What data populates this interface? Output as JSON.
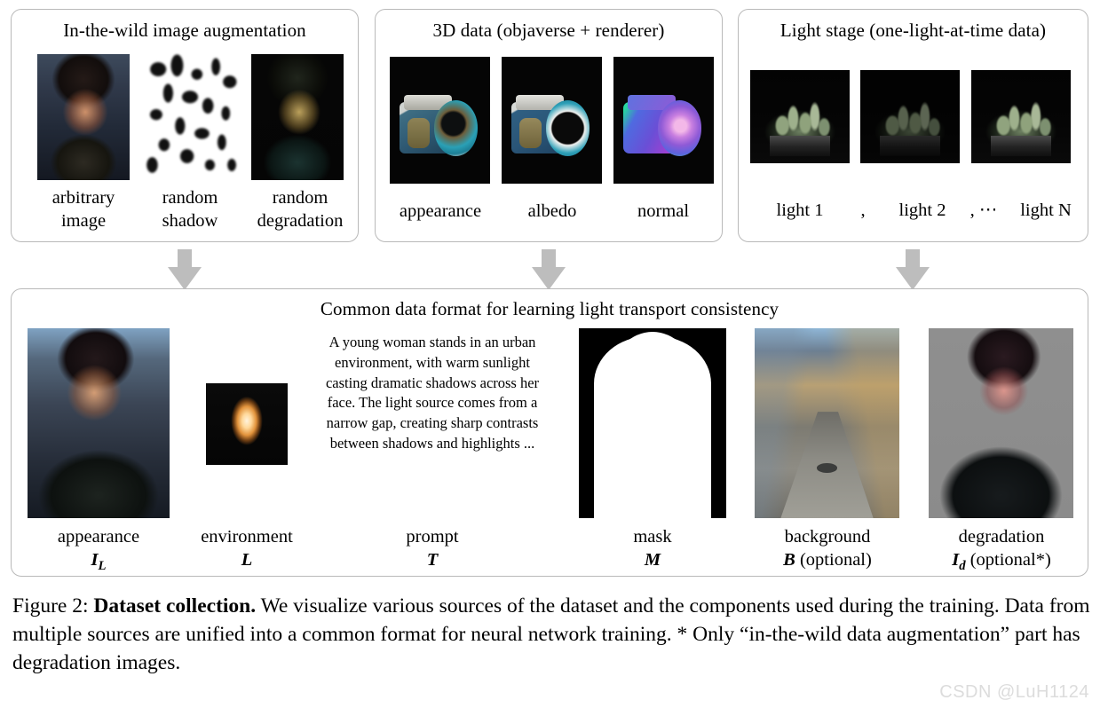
{
  "figure": {
    "caption_prefix": "Figure 2: ",
    "caption_bold": "Dataset collection.",
    "caption_body": " We visualize various sources of the dataset and the components used during the training. Data from multiple sources are unified into a common format for neural network training. * Only “in-the-wild data augmentation” part has degradation images.",
    "watermark": "CSDN @LuH1124"
  },
  "sources": {
    "wild": {
      "title": "In-the-wild image augmentation",
      "items": [
        {
          "label_line1": "arbitrary",
          "label_line2": "image",
          "icon": "portrait-photo"
        },
        {
          "label_line1": "random",
          "label_line2": "shadow",
          "icon": "shadow-mask-photo"
        },
        {
          "label_line1": "random",
          "label_line2": "degradation",
          "icon": "degraded-portrait-photo"
        }
      ]
    },
    "threed": {
      "title": "3D data (objaverse + renderer)",
      "items": [
        {
          "label_line1": "appearance",
          "label_line2": "",
          "icon": "camera-render-appearance"
        },
        {
          "label_line1": "albedo",
          "label_line2": "",
          "icon": "camera-render-albedo"
        },
        {
          "label_line1": "normal",
          "label_line2": "",
          "icon": "camera-render-normal"
        }
      ]
    },
    "lightstage": {
      "title": "Light stage (one-light-at-time data)",
      "items": [
        {
          "label": "light 1",
          "icon": "plant-olat-photo-1"
        },
        {
          "label": "light 2",
          "icon": "plant-olat-photo-2"
        },
        {
          "label": "light N",
          "icon": "plant-olat-photo-n"
        }
      ],
      "separator_1": ",",
      "separator_2": ", ⋯"
    }
  },
  "arrows": {
    "glyph": "down-arrow",
    "color": "#bdbdbd",
    "count": 3
  },
  "common": {
    "title": "Common data format for learning light transport consistency",
    "prompt_text": "A young woman stands in an urban environment, with warm sunlight casting dramatic shadows across her face. The light source comes from a narrow gap, creating sharp contrasts between shadows and highlights ...",
    "items": [
      {
        "name": "appearance",
        "symbol": "I",
        "subscript": "L",
        "suffix": "",
        "icon": "woman-portrait-photo"
      },
      {
        "name": "environment",
        "symbol": "L",
        "subscript": "",
        "suffix": "",
        "icon": "environment-map-photo"
      },
      {
        "name": "prompt",
        "symbol": "T",
        "subscript": "",
        "suffix": "",
        "icon": "prompt-text-block"
      },
      {
        "name": "mask",
        "symbol": "M",
        "subscript": "",
        "suffix": "",
        "icon": "alpha-mask-photo"
      },
      {
        "name": "background",
        "symbol": "B",
        "subscript": "",
        "suffix": " (optional)",
        "icon": "street-background-photo"
      },
      {
        "name": "degradation",
        "symbol": "I",
        "subscript": "d",
        "suffix": " (optional*)",
        "icon": "degraded-woman-photo"
      }
    ]
  },
  "colors": {
    "panel_border": "#b9b9b9",
    "arrow_gray": "#bdbdbd",
    "watermark_gray": "#dcdcdc",
    "page_background": "#ffffff"
  }
}
